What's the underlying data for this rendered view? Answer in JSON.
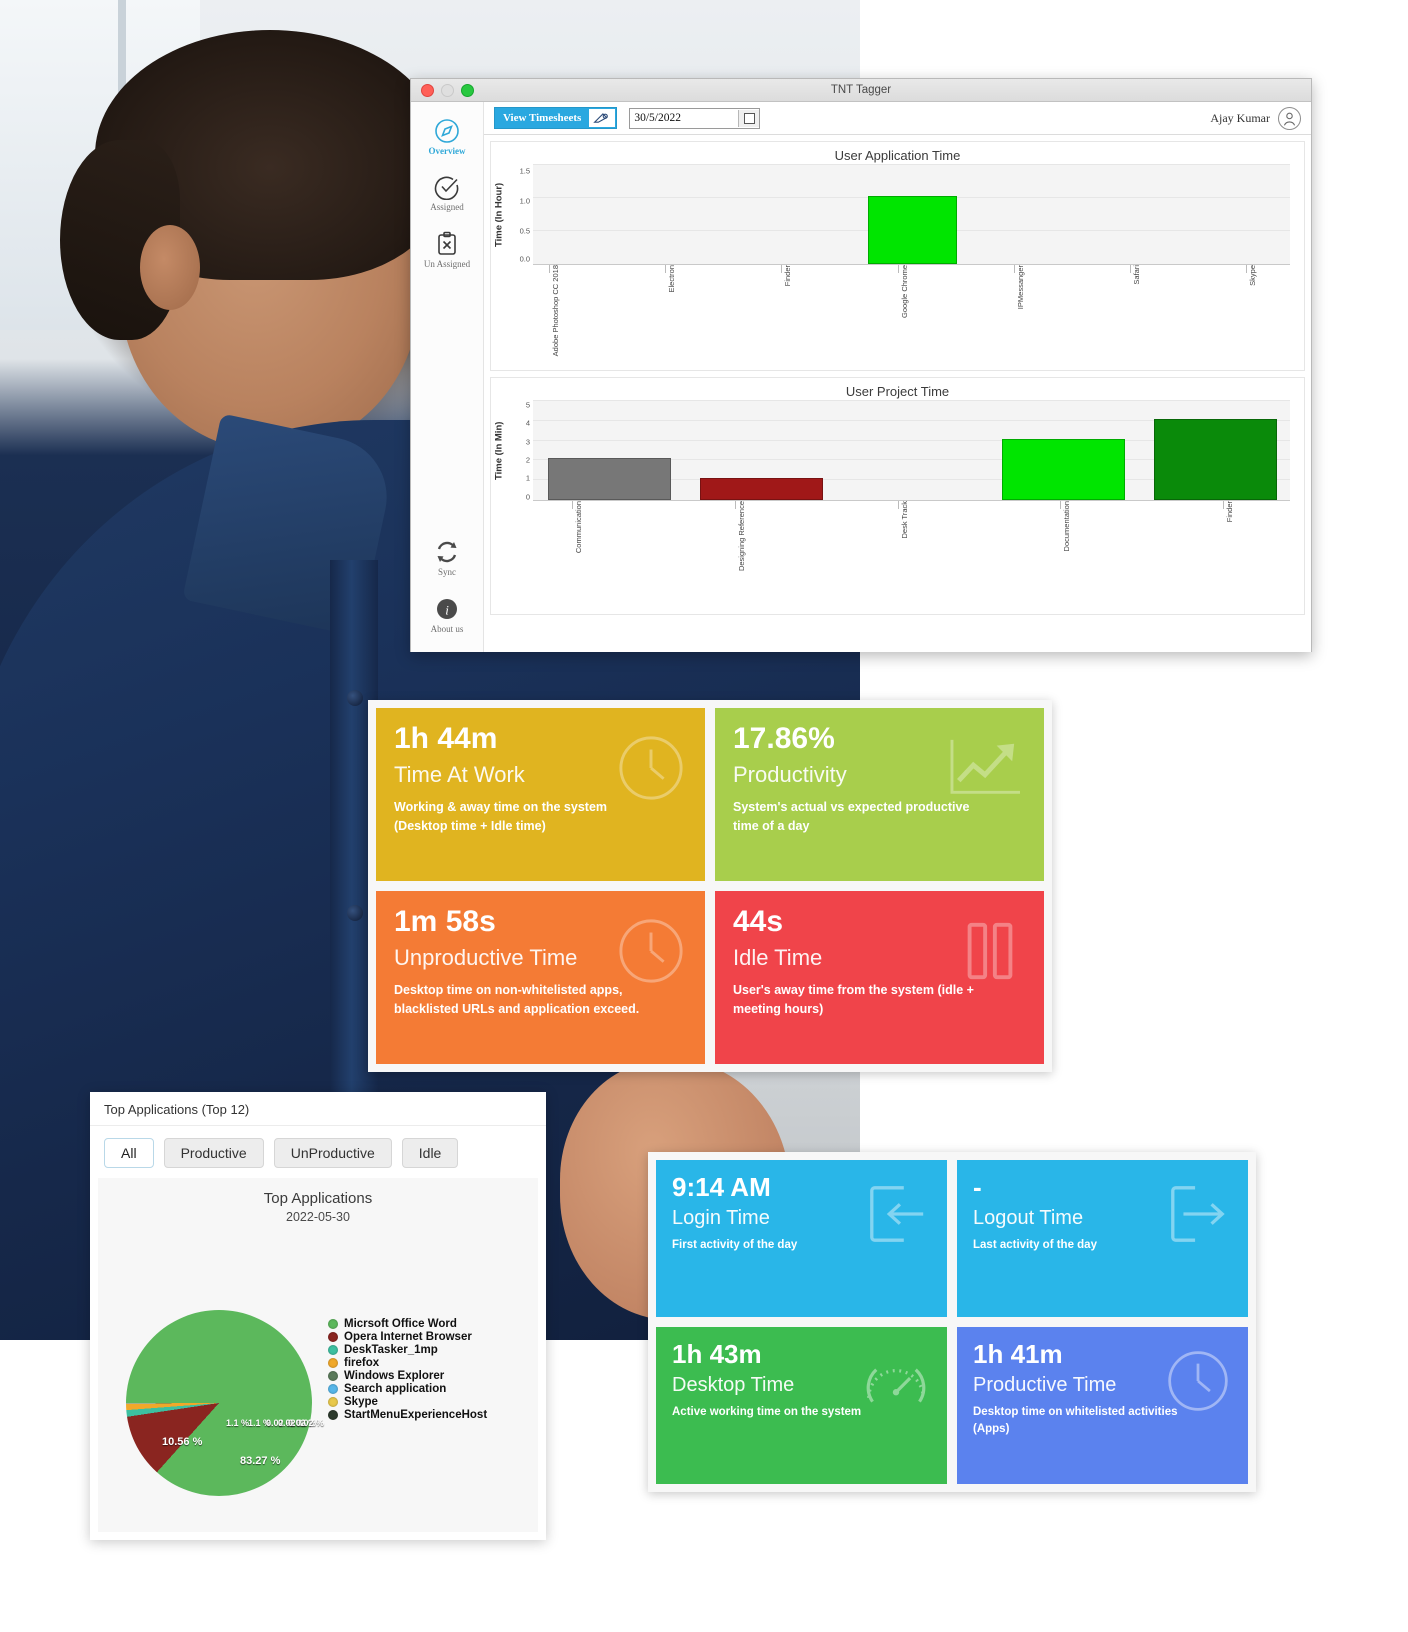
{
  "window": {
    "title": "TNT Tagger",
    "traffic_lights": [
      "close-red",
      "minimize-grey",
      "zoom-green"
    ]
  },
  "sidebar": {
    "items": [
      {
        "label": "Overview",
        "icon": "compass-icon",
        "active": true
      },
      {
        "label": "Assigned",
        "icon": "check-circle-icon",
        "active": false
      },
      {
        "label": "Un Assigned",
        "icon": "clipboard-x-icon",
        "active": false
      }
    ],
    "bottom_items": [
      {
        "label": "Sync",
        "icon": "sync-icon"
      },
      {
        "label": "About us",
        "icon": "info-icon"
      }
    ]
  },
  "toolbar": {
    "view_timesheets_label": "View Timesheets",
    "view_timesheets_icon": "timesheet-pen-icon",
    "date_value": "30/5/2022",
    "calendar_icon": "calendar-icon",
    "user_name": "Ajay Kumar",
    "avatar_icon": "user-avatar-icon"
  },
  "chart_data": [
    {
      "type": "bar",
      "title": "User Application Time",
      "xlabel": "",
      "ylabel": "Time (In Hour)",
      "ylim": [
        0,
        1.5
      ],
      "yticks": [
        "0.0",
        "0.5",
        "1.0",
        "1.5"
      ],
      "grid": true,
      "categories": [
        "Adobe Photoshop CC 2018",
        "Electron",
        "Finder",
        "Google Chrome",
        "IPMessanger",
        "Safari",
        "Skype"
      ],
      "values": [
        0,
        0,
        0,
        1.0,
        0,
        0,
        0
      ],
      "colors": [
        "#00e500",
        "#00e500",
        "#00e500",
        "#00e500",
        "#00e500",
        "#00e500",
        "#00e500"
      ]
    },
    {
      "type": "bar",
      "title": "User Project Time",
      "xlabel": "",
      "ylabel": "Time (In Min)",
      "ylim": [
        0,
        5
      ],
      "yticks": [
        "0",
        "1",
        "2",
        "3",
        "4",
        "5"
      ],
      "grid": true,
      "categories": [
        "Communication",
        "Designing Reference",
        "Desk Track",
        "Documentation",
        "Finder"
      ],
      "values": [
        2,
        1,
        0,
        3,
        4
      ],
      "colors": [
        "#777777",
        "#a01818",
        "#f4f4f4",
        "#00e500",
        "#0a8a0a"
      ]
    },
    {
      "type": "pie",
      "title": "Top Applications",
      "subtitle": "2022-05-30",
      "labels": [
        "Micrsoft Office Word",
        "Opera Internet Browser",
        "DeskTasker_1mp",
        "firefox",
        "Windows Explorer",
        "Search application",
        "Skype",
        "StartMenuExperienceHost"
      ],
      "values": [
        83.27,
        10.56,
        1.1,
        1.1,
        0.02,
        0.02,
        0.02,
        0.02
      ],
      "value_labels": [
        "83.27 %",
        "10.56 %",
        "1.1 %",
        "1.1 %",
        "0.02 %",
        "0.02 %",
        "0.02 %",
        "0.02 %"
      ],
      "colors": [
        "#5cb85c",
        "#8a2520",
        "#3dbfa0",
        "#f0a82a",
        "#5a7a5a",
        "#57b6e8",
        "#e8c84a",
        "#2d3a2d"
      ],
      "legend_position": "right"
    }
  ],
  "kpi_cards": [
    {
      "value": "1h 44m",
      "name": "Time At Work",
      "desc": "Working & away time on the system (Desktop time + Idle time)",
      "color": "#e0b420",
      "icon": "clock-icon"
    },
    {
      "value": "17.86%",
      "name": "Productivity",
      "desc": "System's actual vs expected productive time of a day",
      "color": "#a8ce4c",
      "icon": "trend-up-icon"
    },
    {
      "value": "1m 58s",
      "name": "Unproductive Time",
      "desc": "Desktop time on non-whitelisted apps, blacklisted URLs and application exceed.",
      "color": "#f47b35",
      "icon": "clock-icon"
    },
    {
      "value": "44s",
      "name": "Idle Time",
      "desc": "User's away time from the system (idle + meeting hours)",
      "color": "#f0444a",
      "icon": "pause-icon"
    }
  ],
  "kpi_cards2": [
    {
      "value": "9:14 AM",
      "name": "Login Time",
      "desc": "First activity of the day",
      "color": "#29b6e8",
      "icon": "login-arrow-icon"
    },
    {
      "value": "-",
      "name": "Logout Time",
      "desc": "Last activity of the day",
      "color": "#29b6e8",
      "icon": "logout-arrow-icon"
    },
    {
      "value": "1h 43m",
      "name": "Desktop Time",
      "desc": "Active working time on the system",
      "color": "#3cbc50",
      "icon": "gauge-icon"
    },
    {
      "value": "1h 41m",
      "name": "Productive Time",
      "desc": "Desktop time on whitelisted activities (Apps)",
      "color": "#5b82ee",
      "icon": "clock-icon"
    }
  ],
  "top_applications": {
    "header": "Top Applications (Top 12)",
    "tabs": [
      {
        "label": "All",
        "active": true
      },
      {
        "label": "Productive",
        "active": false
      },
      {
        "label": "UnProductive",
        "active": false
      },
      {
        "label": "Idle",
        "active": false
      }
    ]
  }
}
